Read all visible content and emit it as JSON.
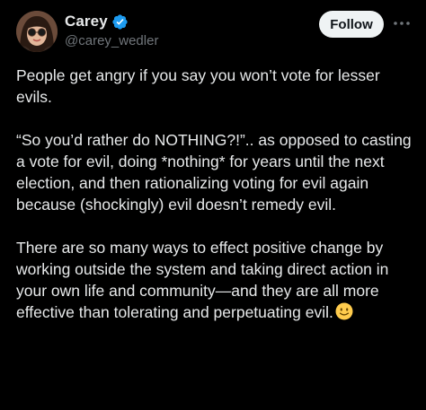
{
  "author": {
    "display_name": "Carey",
    "handle": "@carey_wedler",
    "verified": true,
    "avatar_icon": "profile-photo-sunglasses"
  },
  "actions": {
    "follow_label": "Follow",
    "more_icon": "more-horizontal-icon"
  },
  "tweet": {
    "paragraphs": [
      "People get angry if you say you won’t vote for lesser evils.",
      "“So you’d rather do NOTHING?!”.. as opposed to casting a vote for evil, doing *nothing* for years until the next election, and then rationalizing voting for evil again because (shockingly) evil doesn’t remedy evil.",
      "There are so many ways to effect positive change by working outside the system and taking direct action in your own life and community—and they are all more effective than tolerating and perpetuating evil."
    ],
    "trailing_emoji": "slightly-smiling-face-emoji"
  },
  "colors": {
    "background": "#000000",
    "text_primary": "#e7e9ea",
    "text_secondary": "#71767b",
    "verified_badge": "#1d9bf0",
    "follow_button_bg": "#eff3f4",
    "follow_button_text": "#0f1419"
  }
}
